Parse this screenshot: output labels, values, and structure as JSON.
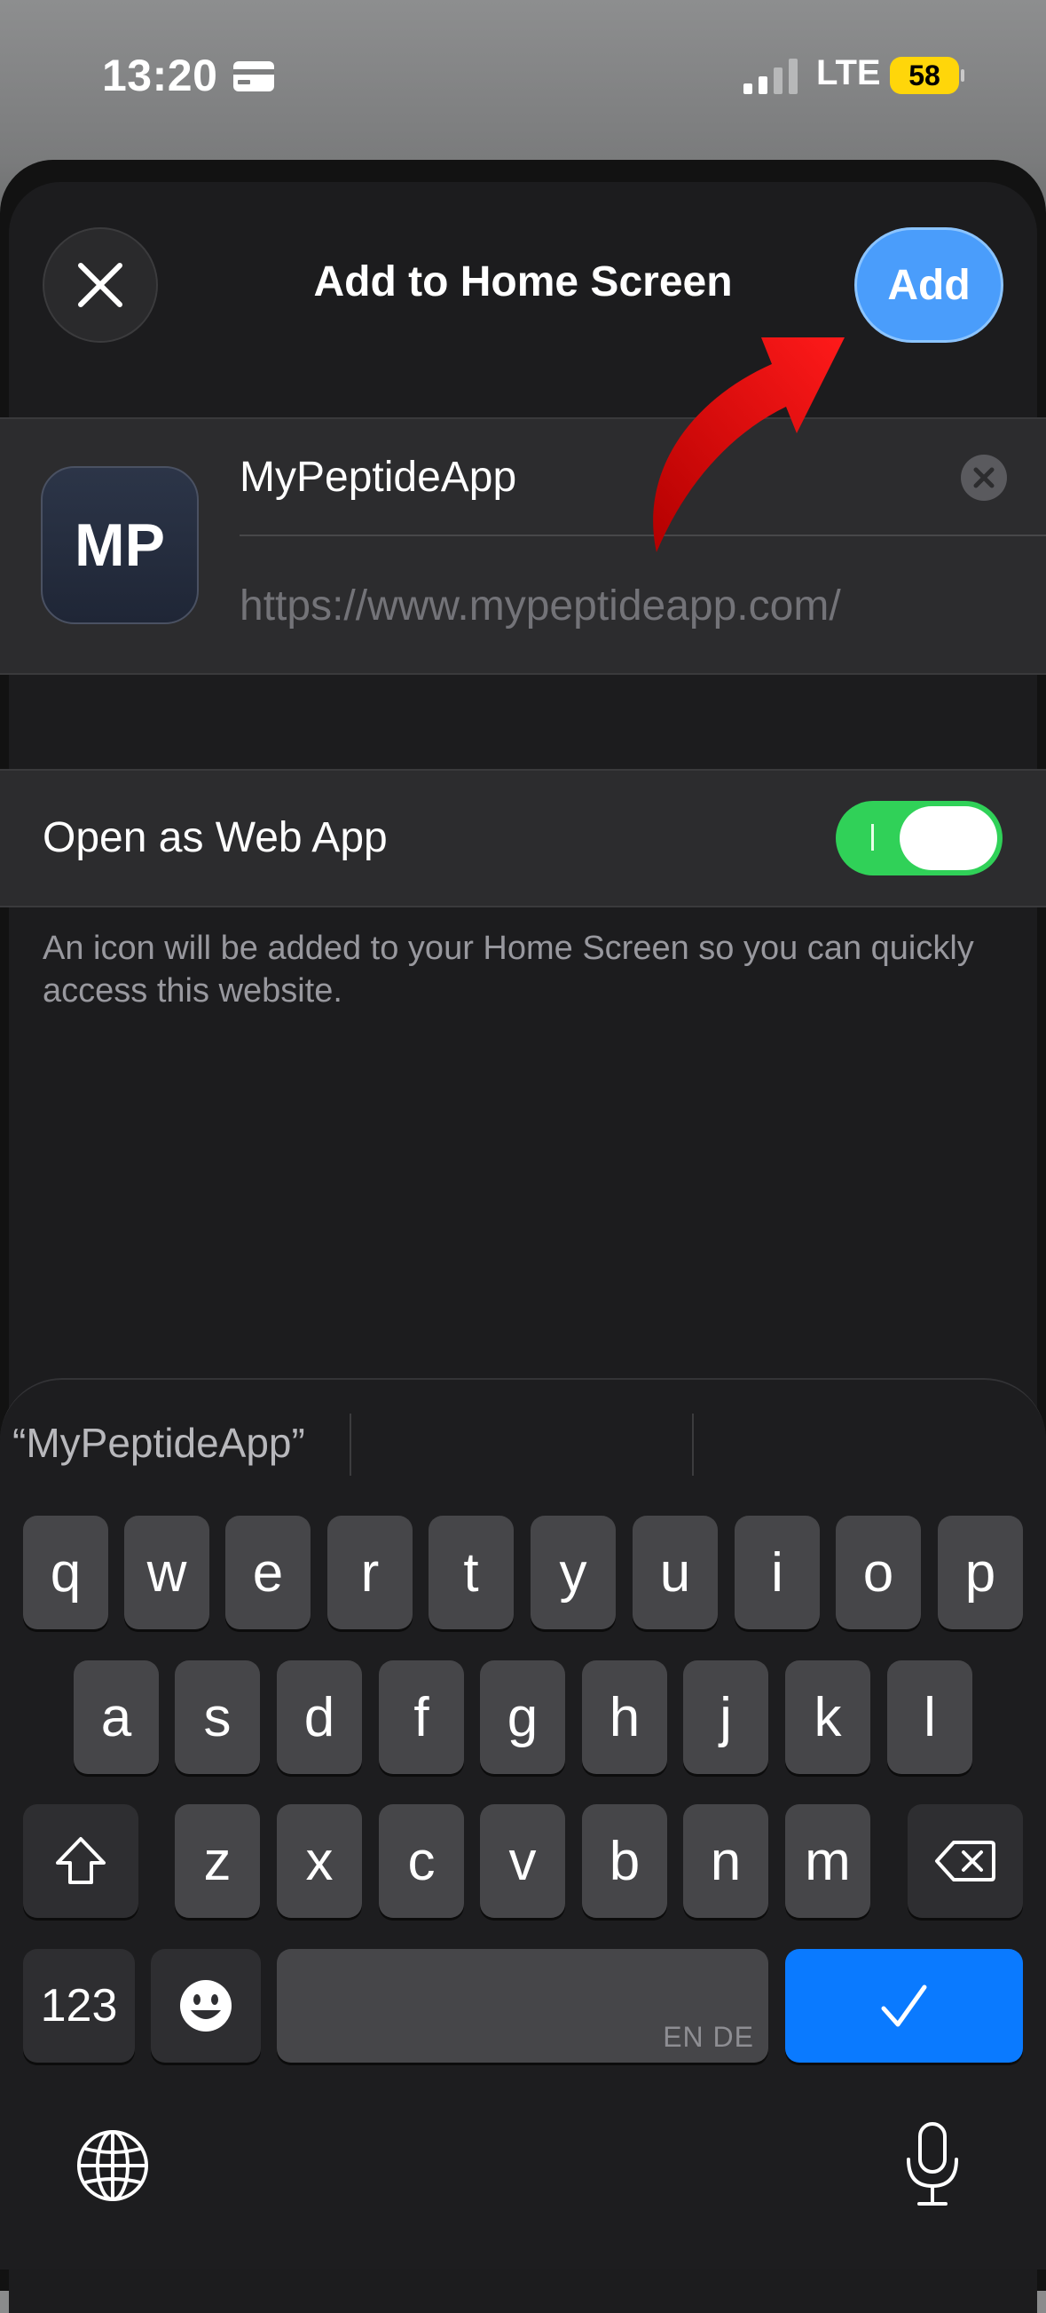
{
  "status_bar": {
    "time": "13:20",
    "network": "LTE",
    "battery": "58",
    "icons": [
      "card-icon",
      "signal-icon",
      "battery-icon"
    ],
    "battery_color": "#ffd60a"
  },
  "sheet": {
    "title": "Add to Home Screen",
    "add_label": "Add",
    "close_icon": "close-icon",
    "accent_color": "#4a9dfb"
  },
  "app": {
    "icon_text": "MP",
    "name": "MyPeptideApp",
    "url": "https://www.mypeptideapp.com/"
  },
  "web_app": {
    "label": "Open as Web App",
    "enabled": true,
    "toggle_color": "#30d158"
  },
  "footnote": "An icon will be added to your Home Screen so you can quickly access this website.",
  "keyboard": {
    "suggestion": "“MyPeptideApp”",
    "row1": [
      "q",
      "w",
      "e",
      "r",
      "t",
      "y",
      "u",
      "i",
      "o",
      "p"
    ],
    "row2": [
      "a",
      "s",
      "d",
      "f",
      "g",
      "h",
      "j",
      "k",
      "l"
    ],
    "row3": [
      "z",
      "x",
      "c",
      "v",
      "b",
      "n",
      "m"
    ],
    "numbers_label": "123",
    "space_language": "EN DE",
    "icons": [
      "shift-icon",
      "backspace-icon",
      "emoji-icon",
      "checkmark-icon",
      "globe-icon",
      "microphone-icon"
    ],
    "return_color": "#0a7aff"
  }
}
